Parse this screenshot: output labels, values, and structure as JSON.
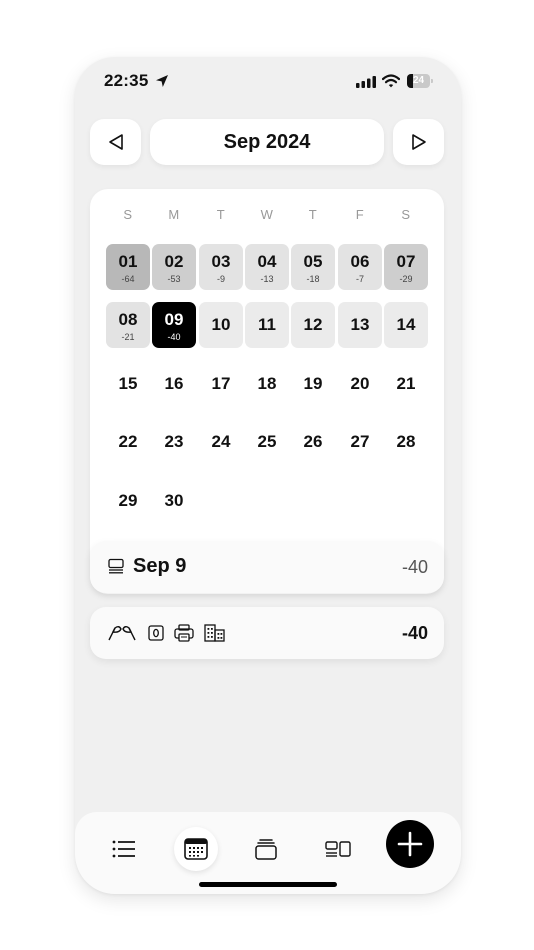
{
  "status": {
    "time": "22:35",
    "battery": "24",
    "battery_level": 0.24
  },
  "header": {
    "month_label": "Sep 2024"
  },
  "calendar": {
    "weekdays": [
      "S",
      "M",
      "T",
      "W",
      "T",
      "F",
      "S"
    ],
    "days": [
      {
        "day": "01",
        "value": "-64",
        "shade": "dark"
      },
      {
        "day": "02",
        "value": "-53",
        "shade": "mid"
      },
      {
        "day": "03",
        "value": "-9",
        "shade": "light"
      },
      {
        "day": "04",
        "value": "-13",
        "shade": "light"
      },
      {
        "day": "05",
        "value": "-18",
        "shade": "light"
      },
      {
        "day": "06",
        "value": "-7",
        "shade": "light"
      },
      {
        "day": "07",
        "value": "-29",
        "shade": "mid"
      },
      {
        "day": "08",
        "value": "-21",
        "shade": "light"
      },
      {
        "day": "09",
        "value": "-40",
        "shade": "selected"
      },
      {
        "day": "10",
        "value": "",
        "shade": "lighter"
      },
      {
        "day": "11",
        "value": "",
        "shade": "lighter"
      },
      {
        "day": "12",
        "value": "",
        "shade": "lighter"
      },
      {
        "day": "13",
        "value": "",
        "shade": "lighter"
      },
      {
        "day": "14",
        "value": "",
        "shade": "lighter"
      },
      {
        "day": "15",
        "value": "",
        "shade": "none"
      },
      {
        "day": "16",
        "value": "",
        "shade": "none"
      },
      {
        "day": "17",
        "value": "",
        "shade": "none"
      },
      {
        "day": "18",
        "value": "",
        "shade": "none"
      },
      {
        "day": "19",
        "value": "",
        "shade": "none"
      },
      {
        "day": "20",
        "value": "",
        "shade": "none"
      },
      {
        "day": "21",
        "value": "",
        "shade": "none"
      },
      {
        "day": "22",
        "value": "",
        "shade": "none"
      },
      {
        "day": "23",
        "value": "",
        "shade": "none"
      },
      {
        "day": "24",
        "value": "",
        "shade": "none"
      },
      {
        "day": "25",
        "value": "",
        "shade": "none"
      },
      {
        "day": "26",
        "value": "",
        "shade": "none"
      },
      {
        "day": "27",
        "value": "",
        "shade": "none"
      },
      {
        "day": "28",
        "value": "",
        "shade": "none"
      },
      {
        "day": "29",
        "value": "",
        "shade": "none"
      },
      {
        "day": "30",
        "value": "",
        "shade": "none"
      }
    ]
  },
  "selected_day": {
    "title": "Sep 9",
    "total": "-40",
    "icon": "list-icon"
  },
  "entry": {
    "icons": [
      "flags-icon",
      "zero-box-icon",
      "printer-icon",
      "buildings-icon"
    ],
    "value": "-40"
  },
  "tabbar": {
    "tabs": [
      "list-icon",
      "calendar-icon",
      "stack-icon",
      "layout-icon"
    ],
    "active": "calendar-icon",
    "add": "plus-icon"
  },
  "colors": {
    "selected": "#000000",
    "shade_dark": "#b8b8b8",
    "shade_mid": "#cecece",
    "shade_light": "#e3e3e3",
    "shade_lighter": "#ebebeb"
  }
}
